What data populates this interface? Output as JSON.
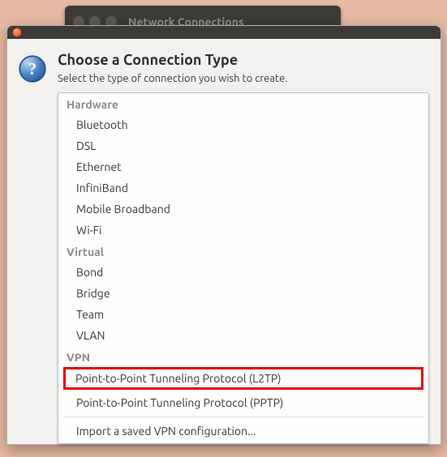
{
  "bg_window": {
    "title": "Network Connections"
  },
  "dialog": {
    "heading": "Choose a Connection Type",
    "subtext": "Select the type of connection you wish to create.",
    "groups": {
      "hardware": {
        "label": "Hardware",
        "items": [
          "Bluetooth",
          "DSL",
          "Ethernet",
          "InfiniBand",
          "Mobile Broadband",
          "Wi-Fi"
        ]
      },
      "virtual": {
        "label": "Virtual",
        "items": [
          "Bond",
          "Bridge",
          "Team",
          "VLAN"
        ]
      },
      "vpn": {
        "label": "VPN",
        "items": [
          "Point-to-Point Tunneling Protocol (L2TP)",
          "Point-to-Point Tunneling Protocol (PPTP)"
        ],
        "import": "Import a saved VPN configuration..."
      }
    }
  }
}
